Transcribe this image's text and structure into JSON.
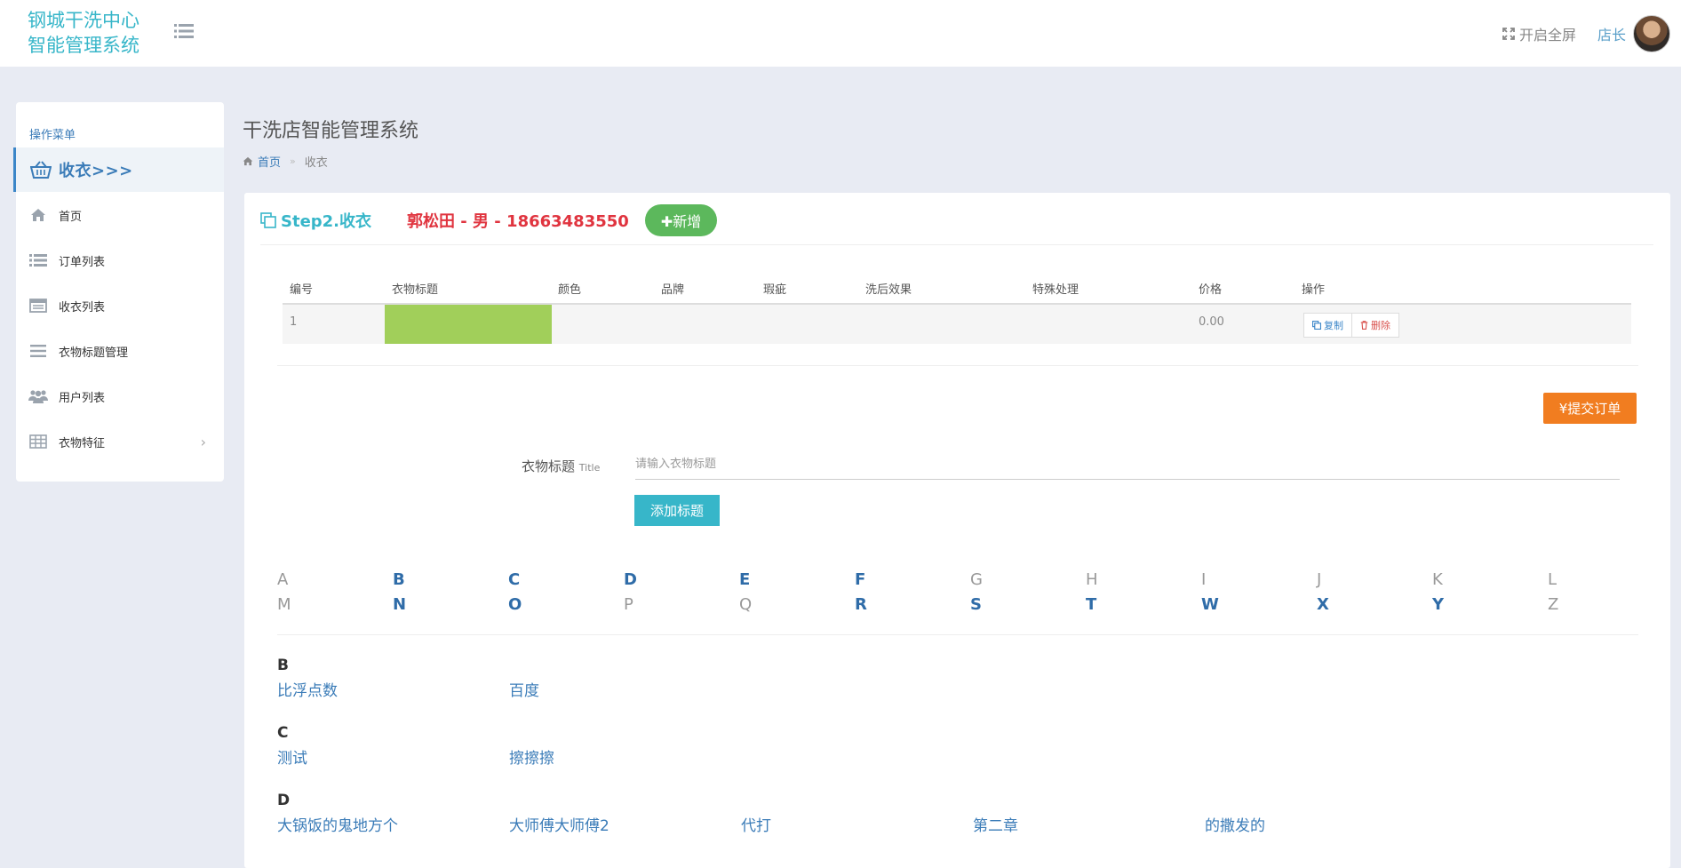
{
  "header": {
    "logo_line1": "钢城干洗中心",
    "logo_line2": "智能管理系统",
    "fullscreen_label": "开启全屏",
    "user_name": "店长"
  },
  "sidebar": {
    "caption": "操作菜单",
    "active_label": "收衣>>>",
    "items": [
      {
        "label": "首页",
        "icon": "home-icon"
      },
      {
        "label": "订单列表",
        "icon": "list-icon"
      },
      {
        "label": "收衣列表",
        "icon": "window-list-icon"
      },
      {
        "label": "衣物标题管理",
        "icon": "bars-icon"
      },
      {
        "label": "用户列表",
        "icon": "users-icon"
      },
      {
        "label": "衣物特征",
        "icon": "table-icon",
        "has_submenu": true
      }
    ]
  },
  "page": {
    "title": "干洗店智能管理系统",
    "breadcrumb_home": "首页",
    "breadcrumb_current": "收衣"
  },
  "step": {
    "title": "Step2.收衣",
    "customer": "郭松田 - 男 - 18663483550",
    "add_label": "✚新增"
  },
  "table": {
    "headers": [
      "编号",
      "衣物标题",
      "颜色",
      "品牌",
      "瑕疵",
      "洗后效果",
      "特殊处理",
      "价格",
      "操作"
    ],
    "rows": [
      {
        "no": "1",
        "title": "",
        "color": "",
        "brand": "",
        "flaw": "",
        "effect": "",
        "special": "",
        "price": "0.00"
      }
    ],
    "copy_label": "复制",
    "delete_label": "删除"
  },
  "form": {
    "submit_label": "¥提交订单",
    "title_label": "衣物标题",
    "title_label_small": "Title",
    "title_placeholder": "请输入衣物标题",
    "title_value": "",
    "add_title_label": "添加标题"
  },
  "alphabet": [
    {
      "letter": "A",
      "active": false
    },
    {
      "letter": "B",
      "active": true
    },
    {
      "letter": "C",
      "active": true
    },
    {
      "letter": "D",
      "active": true
    },
    {
      "letter": "E",
      "active": true
    },
    {
      "letter": "F",
      "active": true
    },
    {
      "letter": "G",
      "active": false
    },
    {
      "letter": "H",
      "active": false
    },
    {
      "letter": "I",
      "active": false
    },
    {
      "letter": "J",
      "active": false
    },
    {
      "letter": "K",
      "active": false
    },
    {
      "letter": "L",
      "active": false
    },
    {
      "letter": "M",
      "active": false
    },
    {
      "letter": "N",
      "active": true
    },
    {
      "letter": "O",
      "active": true
    },
    {
      "letter": "P",
      "active": false
    },
    {
      "letter": "Q",
      "active": false
    },
    {
      "letter": "R",
      "active": true
    },
    {
      "letter": "S",
      "active": true
    },
    {
      "letter": "T",
      "active": true
    },
    {
      "letter": "W",
      "active": true
    },
    {
      "letter": "X",
      "active": true
    },
    {
      "letter": "Y",
      "active": true
    },
    {
      "letter": "Z",
      "active": false
    }
  ],
  "title_groups": [
    {
      "letter": "B",
      "items": [
        "比浮点数",
        "百度"
      ]
    },
    {
      "letter": "C",
      "items": [
        "测试",
        "擦擦擦"
      ]
    },
    {
      "letter": "D",
      "items": [
        "大锅饭的鬼地方个",
        "大师傅大师傅2",
        "代打",
        "第二章",
        "的撒发的"
      ]
    }
  ],
  "colors": {
    "accent_teal": "#37b6c9",
    "link_blue": "#3b7cb8",
    "customer_red": "#e0343f",
    "add_green": "#5cb85c",
    "submit_orange": "#f17d20",
    "row_highlight": "#a1cf5a"
  }
}
